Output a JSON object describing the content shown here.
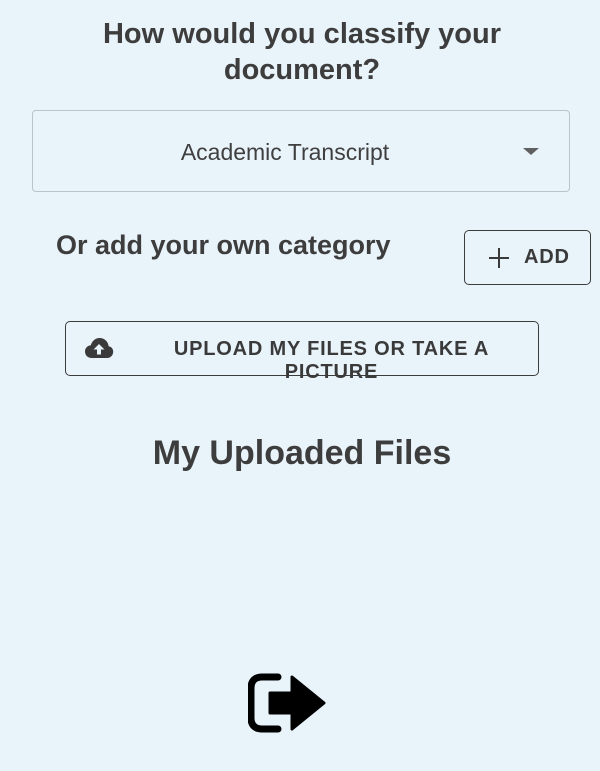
{
  "question": "How would you classify your document?",
  "category_select": {
    "selected": "Academic Transcript"
  },
  "own_category": {
    "label": "Or add your own category",
    "add_button": "ADD"
  },
  "upload_button": "UPLOAD MY FILES OR TAKE A PICTURE",
  "uploaded_files_title": "My Uploaded Files",
  "icons": {
    "add": "plus-icon",
    "upload": "cloud-upload-icon",
    "dropdown": "chevron-down-icon",
    "logout": "sign-out-icon"
  },
  "colors": {
    "background": "#e9f3fa",
    "text": "#3d3d3d",
    "border": "#3c3c3c"
  }
}
